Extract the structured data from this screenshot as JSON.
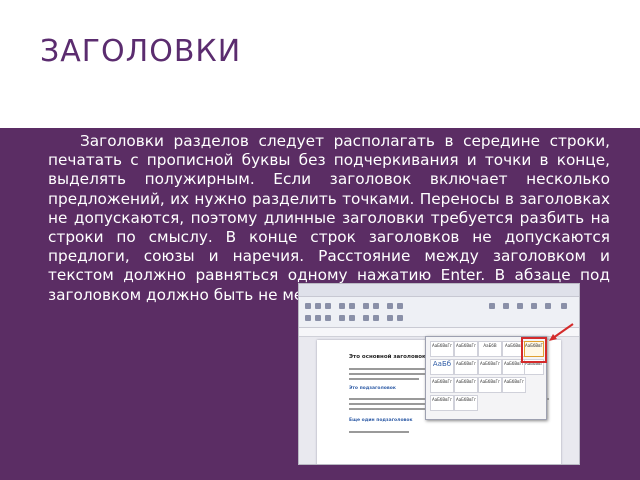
{
  "slide": {
    "title": "ЗАГОЛОВКИ",
    "body": "Заголовки разделов следует располагать в середине строки, печатать с прописной буквы без подчеркивания и точки в конце, выделять полужирным. Если заголовок включает несколько предложений, их нужно разделить точками. Переносы в заголовках не допускаются, поэтому длинные заголовки требуется разбить на строки по смыслу. В конце строк заголовков не допускаются предлоги, союзы и наречия. Расстояние между заголовком и текстом должно равняться одному нажатию Enter. В абзаце под заголовком должно быть не менее трех строк основного текста."
  },
  "screenshot": {
    "doc_heading": "Это основной заголовок",
    "doc_subheading": "Это подзаголовок",
    "doc_subheading2": "Еще один подзаголовок",
    "style_samples": [
      "АаБбВвГг",
      "АаБбВвГг",
      "АаБбВ",
      "АаБбВвГ",
      "АаБбВвГ",
      "АаБб",
      "АаБбВвГг",
      "АаБбВвГг",
      "АаБбВвГг",
      "АаБбВвГг",
      "АаБбВвГг",
      "АаБбВвГг",
      "АаБбВвГг",
      "АаБбВвГг",
      "АаБбВвГг",
      "АаБбВвГг"
    ]
  },
  "colors": {
    "title": "#5b2c6f",
    "band": "#5b2d64",
    "highlight": "#d42b2b"
  }
}
